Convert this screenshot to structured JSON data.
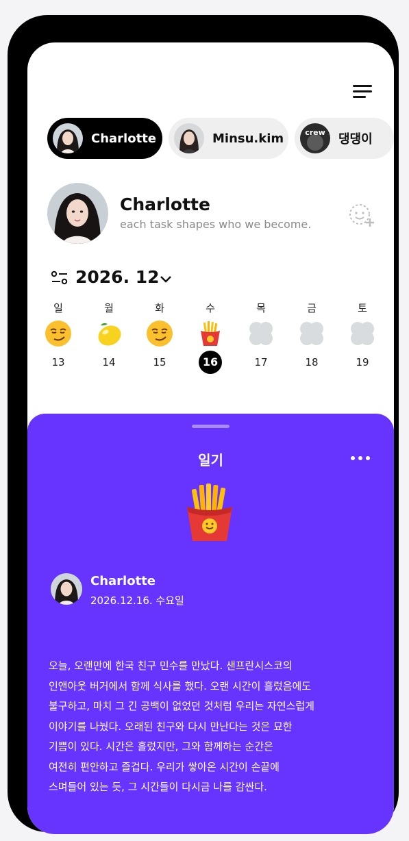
{
  "profiles": [
    {
      "label": "Charlotte",
      "active": true
    },
    {
      "label": "Minsu.kim",
      "active": false
    },
    {
      "label": "댕댕이",
      "active": false,
      "avatar_text": "crew"
    }
  ],
  "profile": {
    "name": "Charlotte",
    "bio": "each task shapes who we become."
  },
  "calendar": {
    "month_label": "2026. 12",
    "days": [
      {
        "dow": "일",
        "date": "13",
        "mood": "smirk-face-emoji",
        "selected": false
      },
      {
        "dow": "월",
        "date": "14",
        "mood": "lemon-emoji",
        "selected": false
      },
      {
        "dow": "화",
        "date": "15",
        "mood": "smirk-face-emoji",
        "selected": false
      },
      {
        "dow": "수",
        "date": "16",
        "mood": "fries-emoji",
        "selected": true
      },
      {
        "dow": "목",
        "date": "17",
        "mood": "empty-mood-placeholder",
        "selected": false
      },
      {
        "dow": "금",
        "date": "18",
        "mood": "empty-mood-placeholder",
        "selected": false
      },
      {
        "dow": "토",
        "date": "19",
        "mood": "empty-mood-placeholder",
        "selected": false
      }
    ]
  },
  "diary": {
    "title": "일기",
    "author_name": "Charlotte",
    "date": "2026.12.16. 수요일",
    "mood": "fries-emoji",
    "lines": [
      "오늘, 오랜만에 한국 친구 민수를 만났다. 샌프란시스코의",
      "인앤아웃 버거에서 함께 식사를 했다. 오랜 시간이 흘렀음에도",
      "불구하고, 마치 그 긴 공백이 없었던 것처럼 우리는 자연스럽게",
      "이야기를 나눴다. 오래된 친구와 다시 만난다는 것은 묘한",
      "기쁨이 있다. 시간은 흘렀지만, 그와 함께하는 순간은",
      "여전히 편안하고 즐겁다. 우리가 쌓아온 시간이 손끝에",
      "스며들어 있는 듯, 그 시간들이 다시금 나를 감싼다."
    ]
  },
  "colors": {
    "sheet_bg": "#6633ff",
    "active_chip_bg": "#000000",
    "inactive_chip_bg": "#efefef",
    "placeholder": "#d9dcde"
  }
}
